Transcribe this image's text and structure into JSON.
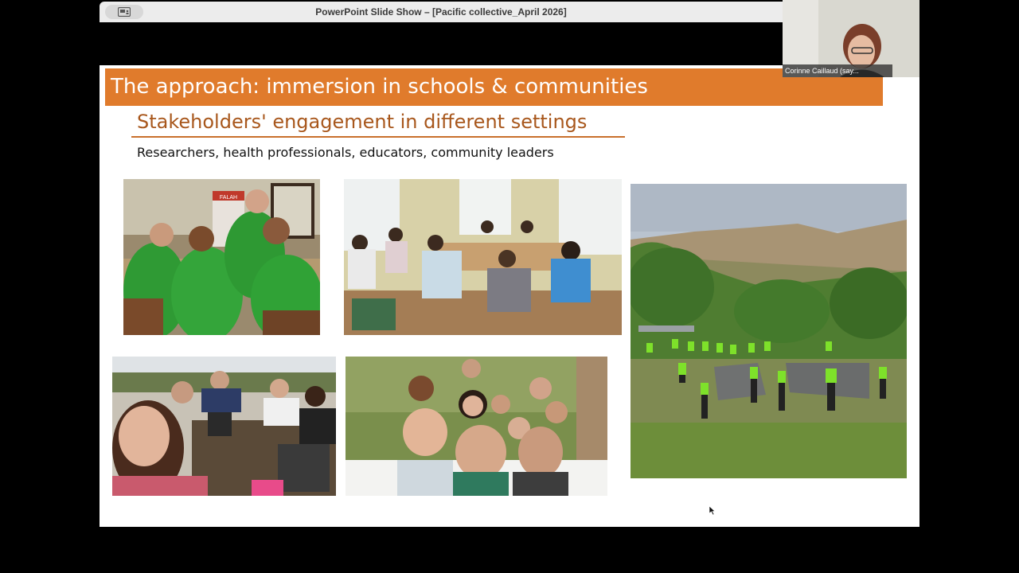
{
  "window": {
    "title": "PowerPoint Slide Show – [Pacific collective_April 2026]",
    "presenter_icon": "presenter-view-icon"
  },
  "slide": {
    "banner_title": "The approach: immersion in schools & communities",
    "subtitle": "Stakeholders' engagement in different settings",
    "stakeholders": "Researchers, health professionals, educators, community leaders",
    "photos": [
      {
        "name": "photo-workshop-green-shirts",
        "poster_text": "FALAH"
      },
      {
        "name": "photo-meeting-room"
      },
      {
        "name": "photo-outdoor-group-hill"
      },
      {
        "name": "photo-selfie-laptop-table"
      },
      {
        "name": "photo-group-selfie-garden"
      }
    ]
  },
  "webcam": {
    "participant_name": "Corinne Caillaud (say..."
  },
  "colors": {
    "banner": "#e07b2c",
    "subtitle": "#a8571c",
    "titlebar": "#ececec"
  }
}
